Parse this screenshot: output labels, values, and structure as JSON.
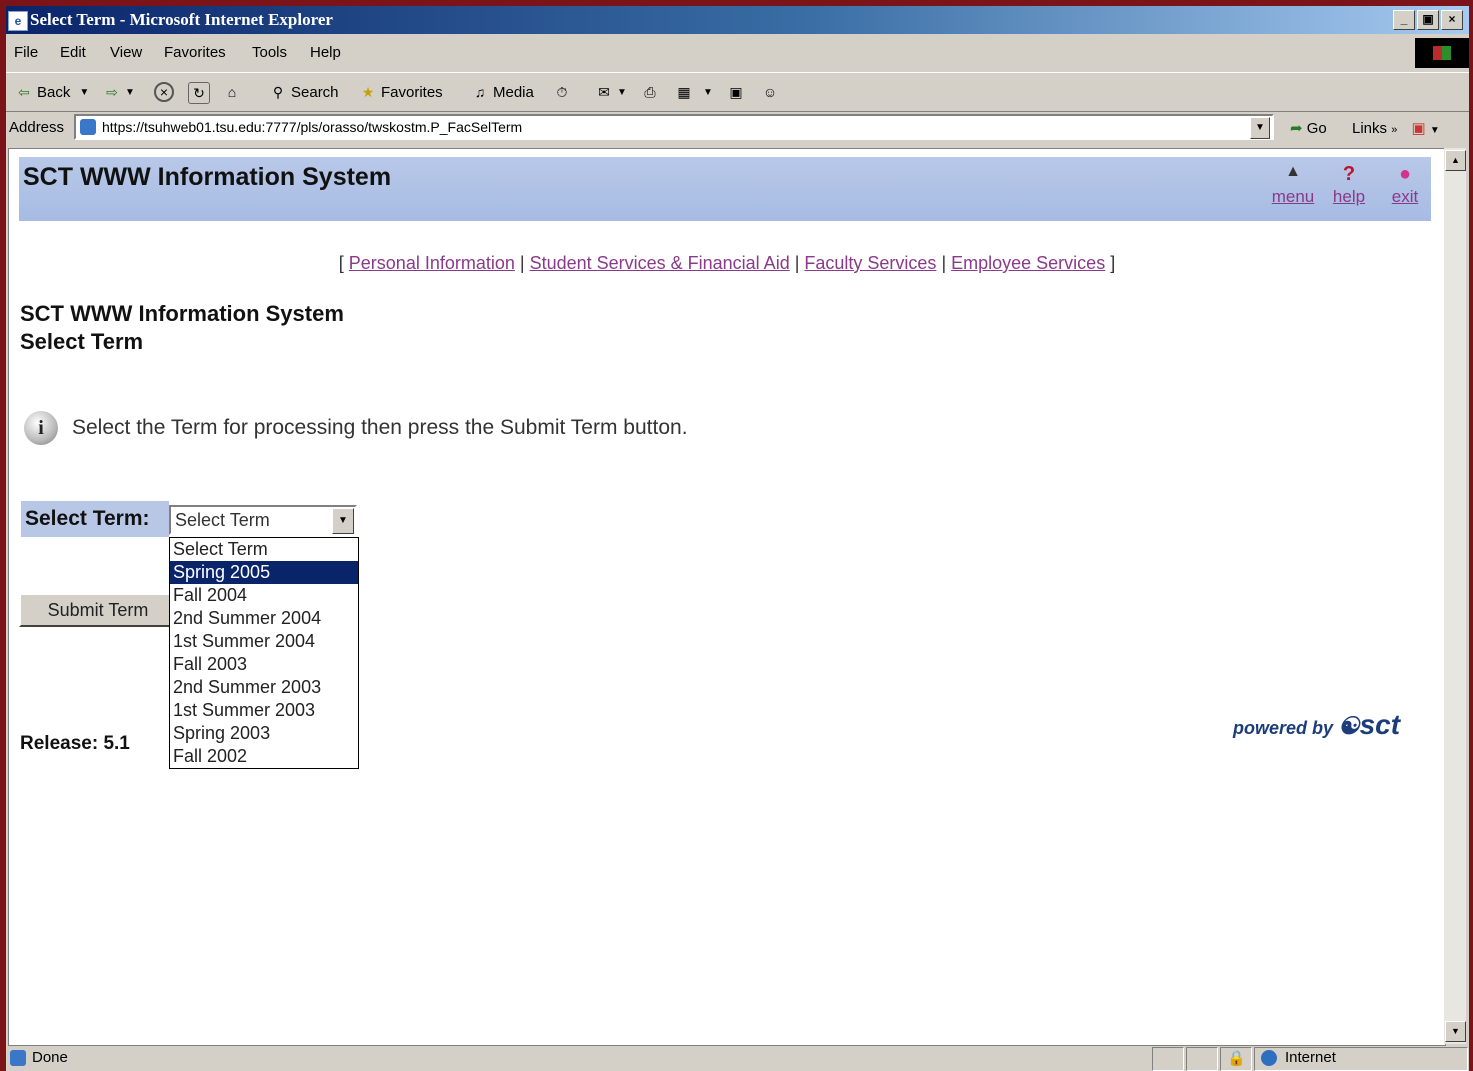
{
  "window": {
    "title": "Select Term - Microsoft Internet Explorer",
    "controls": [
      "_",
      "▣",
      "×"
    ]
  },
  "menu": [
    "File",
    "Edit",
    "View",
    "Favorites",
    "Tools",
    "Help"
  ],
  "toolbar": {
    "back": "Back",
    "search": "Search",
    "favorites": "Favorites",
    "media": "Media"
  },
  "address": {
    "label": "Address",
    "url": "https://tsuhweb01.tsu.edu:7777/pls/orasso/twskostm.P_FacSelTerm",
    "go": "Go",
    "links": "Links"
  },
  "banner": {
    "title": "SCT WWW Information System",
    "nav": [
      {
        "label": "menu",
        "icon": "home-icon",
        "glyph": "▲"
      },
      {
        "label": "help",
        "icon": "help-icon",
        "glyph": "?"
      },
      {
        "label": "exit",
        "icon": "exit-icon",
        "glyph": "●"
      }
    ]
  },
  "top_links": [
    "Personal Information",
    "Student Services & Financial Aid",
    "Faculty Services",
    "Employee Services"
  ],
  "page": {
    "heading1": "SCT WWW Information System",
    "heading2": "Select Term",
    "info": "Select the Term for processing then press the Submit Term button.",
    "term_label": "Select Term:",
    "select_value": "Select Term",
    "options": [
      "Select Term",
      "Spring 2005",
      "Fall 2004",
      "2nd Summer 2004",
      "1st Summer 2004",
      "Fall 2003",
      "2nd Summer 2003",
      "1st Summer 2003",
      "Spring 2003",
      "Fall 2002"
    ],
    "highlighted_option": "Spring 2005",
    "submit": "Submit Term",
    "release": "Release: 5.1",
    "powered_by": "powered by",
    "brand": "sct"
  },
  "status": {
    "text": "Done",
    "zone": "Internet"
  },
  "colors": {
    "banner": "#b8c8e8",
    "link": "#8a3a8a",
    "selection": "#0a246a"
  }
}
